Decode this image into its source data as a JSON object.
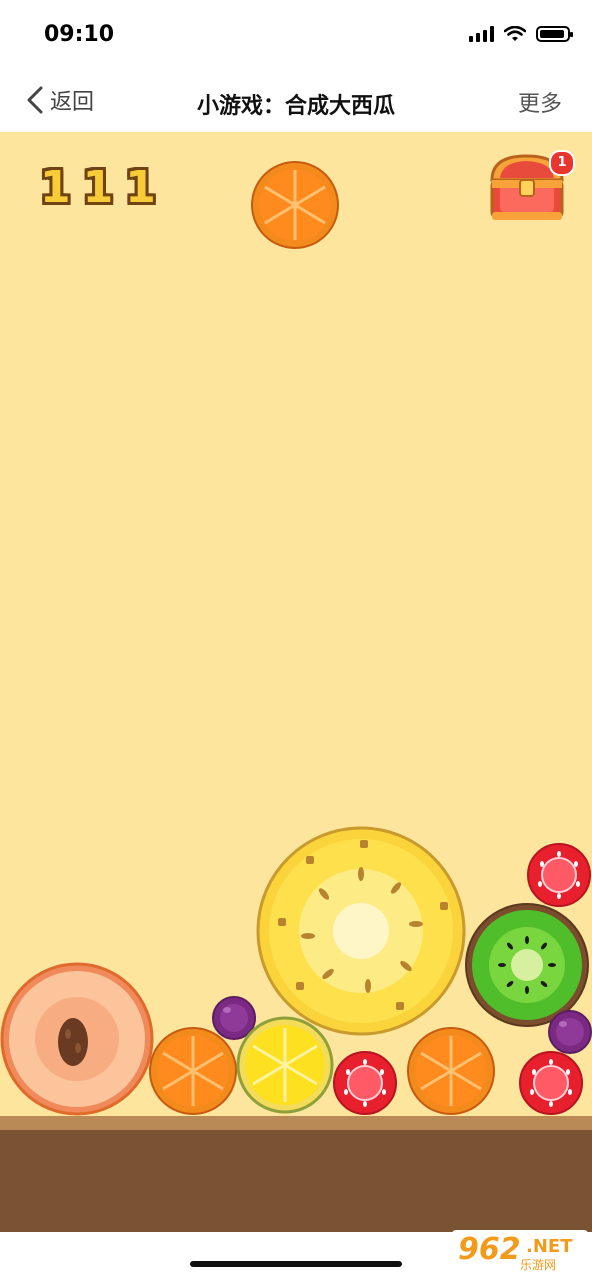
{
  "status_bar": {
    "time": "09:10"
  },
  "nav": {
    "back_label": "返回",
    "title": "小游戏：合成大西瓜",
    "more_label": "更多"
  },
  "game": {
    "score": "111",
    "chest_badge": "1",
    "next_fruit": "orange",
    "fruits_on_board": [
      "peach",
      "orange",
      "grape",
      "lemon",
      "pineapple",
      "strawberry",
      "orange",
      "kiwi",
      "strawberry",
      "grape",
      "strawberry"
    ]
  },
  "watermark": {
    "number": "962",
    "suffix": ".NET",
    "site": "乐游网"
  },
  "colors": {
    "background": "#fde59d",
    "ground": "#7a5335",
    "ground_edge": "#b98a55",
    "score_fill": "#f7cc38"
  }
}
